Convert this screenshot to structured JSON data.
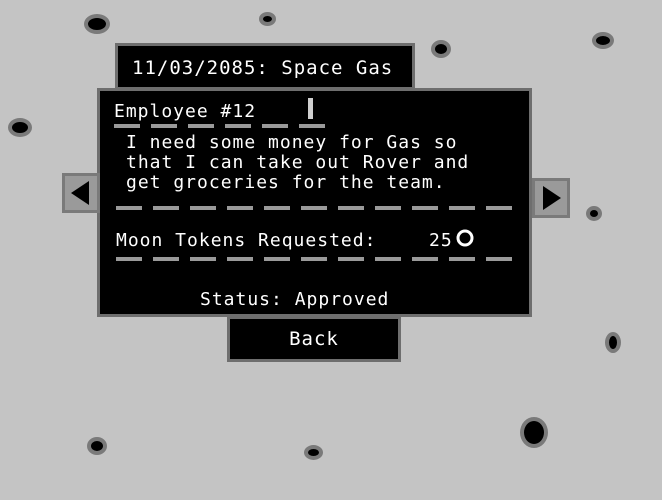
{
  "header": {
    "date_title": "11/03/2085: Space Gas"
  },
  "request": {
    "employee_label": "Employee #12",
    "message": "I need some money for Gas so\nthat I can take out Rover and\nget groceries for the team.",
    "tokens_label": "Moon Tokens Requested:",
    "tokens_value": "25",
    "status_text": "Status: Approved"
  },
  "controls": {
    "back_label": "Back",
    "prev_icon": "left-triangle-arrow",
    "next_icon": "right-triangle-arrow"
  },
  "colors": {
    "background": "#c4c4c4",
    "panel": "#000000",
    "panel_border": "#6e6e6e",
    "text": "#ffffff",
    "dashes": "#9a9a9a"
  }
}
